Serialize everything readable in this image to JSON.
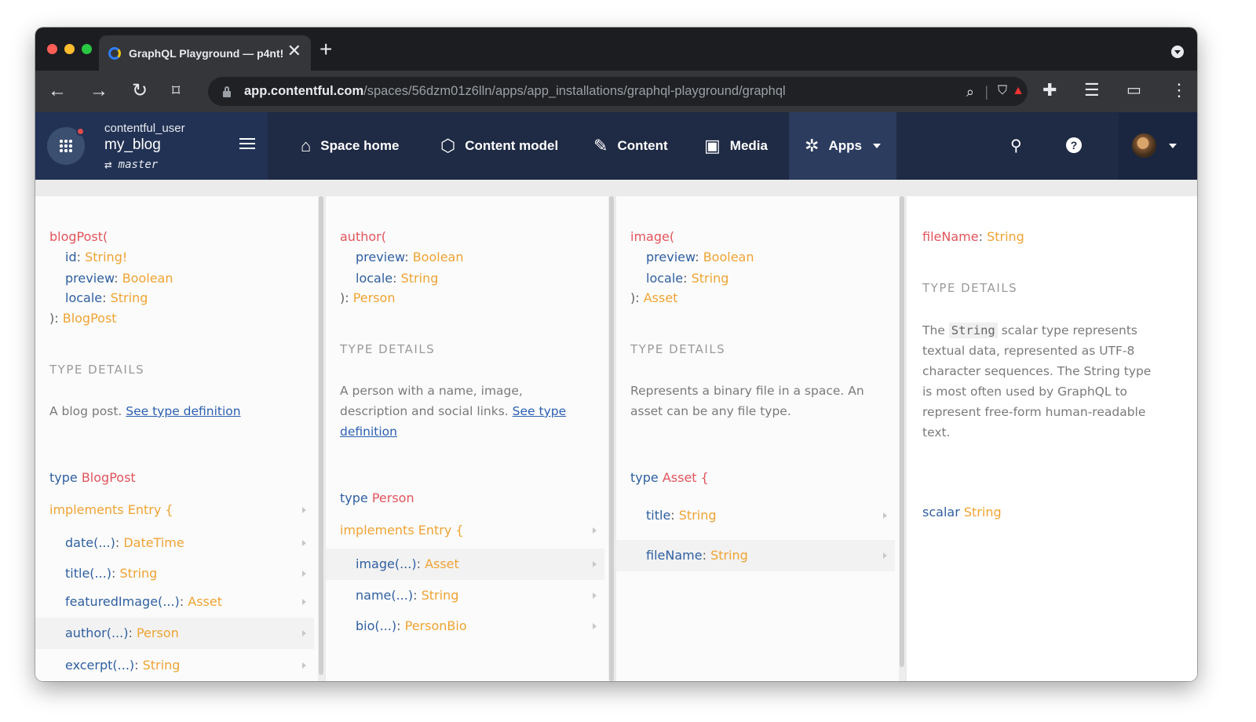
{
  "browser": {
    "tab_title": "GraphQL Playground — p4nt!",
    "url_domain": "app.contentful.com",
    "url_path": "/spaces/56dzm01z6lln/apps/app_installations/graphql-playground/graphql"
  },
  "cf": {
    "user": "contentful_user",
    "space": "my_blog",
    "environment": "master",
    "nav": {
      "space_home": "Space home",
      "content_model": "Content model",
      "content": "Content",
      "media": "Media",
      "apps": "Apps"
    }
  },
  "col1": {
    "name": "blogPost(",
    "args": [
      {
        "name": "id",
        "type": "String!"
      },
      {
        "name": "preview",
        "type": "Boolean"
      },
      {
        "name": "locale",
        "type": "String"
      }
    ],
    "close": "): ",
    "return_type": "BlogPost",
    "details_header": "TYPE DETAILS",
    "description": "A blog post. ",
    "link": "See type definition",
    "type_kw": "type ",
    "type_name": "BlogPost",
    "implements_kw": "implements ",
    "implements_name": "Entry {",
    "fields": [
      {
        "name": "date(...)",
        "type": "DateTime"
      },
      {
        "name": "title(...)",
        "type": "String"
      },
      {
        "name": "featuredImage(...)",
        "type": "Asset"
      },
      {
        "name": "author(...)",
        "type": "Person"
      },
      {
        "name": "excerpt(...)",
        "type": "String"
      }
    ]
  },
  "col2": {
    "name": "author(",
    "args": [
      {
        "name": "preview",
        "type": "Boolean"
      },
      {
        "name": "locale",
        "type": "String"
      }
    ],
    "close": "): ",
    "return_type": "Person",
    "details_header": "TYPE DETAILS",
    "description_l1": "A person with a name, image,",
    "description_l2": "description and social links. ",
    "link_l1": "See type",
    "link_l2": "definition",
    "type_kw": "type ",
    "type_name": "Person",
    "implements_kw": "implements ",
    "implements_name": "Entry {",
    "fields": [
      {
        "name": "image(...)",
        "type": "Asset"
      },
      {
        "name": "name(...)",
        "type": "String"
      },
      {
        "name": "bio(...)",
        "type": "PersonBio"
      }
    ]
  },
  "col3": {
    "name": "image(",
    "args": [
      {
        "name": "preview",
        "type": "Boolean"
      },
      {
        "name": "locale",
        "type": "String"
      }
    ],
    "close": "): ",
    "return_type": "Asset",
    "details_header": "TYPE DETAILS",
    "description_l1": "Represents a binary file in a space. An",
    "description_l2": "asset can be any file type.",
    "type_kw": "type ",
    "type_name": "Asset {",
    "fields": [
      {
        "name": "title",
        "type": "String"
      },
      {
        "name": "fileName",
        "type": "String"
      }
    ]
  },
  "col4": {
    "field_name": "fileName",
    "field_type": "String",
    "details_header": "TYPE DETAILS",
    "desc_the": "The ",
    "desc_code": "String",
    "desc_l1_rest": " scalar type represents",
    "desc_l2": "textual data, represented as UTF-8",
    "desc_l3": "character sequences. The String type",
    "desc_l4": "is most often used by GraphQL to",
    "desc_l5": "represent free-form human-readable",
    "desc_l6": "text.",
    "scalar_kw": "scalar ",
    "scalar_name": "String"
  },
  "colors": {
    "keyword_red": "#e2545c",
    "field_blue": "#2f5fa0",
    "type_orange": "#f0a332",
    "header_bg": "#1f2a44"
  }
}
